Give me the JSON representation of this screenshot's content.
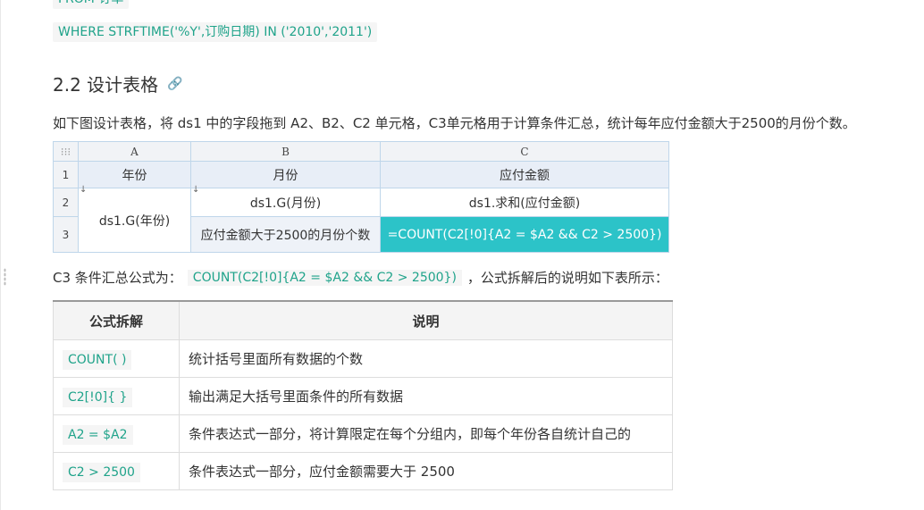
{
  "top_code": {
    "line1": "FROM 订单",
    "line2": "WHERE STRFTIME('%Y',订购日期) IN ('2010','2011')"
  },
  "section": {
    "title": "2.2 设计表格",
    "link_icon": "link-icon"
  },
  "paragraph1": "如下图设计表格，将 ds1 中的字段拖到 A2、B2、C2 单元格，C3单元格用于计算条件汇总，统计每年应付金额大于2500的月份个数。",
  "sheet": {
    "corner_icon": "grid-icon",
    "columns": [
      "A",
      "B",
      "C"
    ],
    "rows": [
      "1",
      "2",
      "3"
    ],
    "r1": [
      "年份",
      "月份",
      "应付金额"
    ],
    "a23": "ds1.G(年份)",
    "b2": "ds1.G(月份)",
    "c2": "ds1.求和(应付金额)",
    "b3": "应付金额大于2500的月份个数",
    "c3": "=COUNT(C2[!0]{A2 = $A2 && C2 > 2500})"
  },
  "paragraph2": {
    "prefix": "C3 条件汇总公式为：",
    "code": "COUNT(C2[!0]{A2 = $A2 && C2 > 2500})",
    "suffix": "，公式拆解后的说明如下表所示："
  },
  "explain_table": {
    "headers": [
      "公式拆解",
      "说明"
    ],
    "rows": [
      {
        "code": "COUNT( )",
        "desc": "统计括号里面所有数据的个数"
      },
      {
        "code": "C2[!0]{ }",
        "desc": "输出满足大括号里面条件的所有数据"
      },
      {
        "code": "A2 = $A2",
        "desc": "条件表达式一部分，将计算限定在每个分组内，即每个年份各自统计自己的"
      },
      {
        "code": "C2 > 2500",
        "desc": "条件表达式一部分，应付金额需要大于 2500"
      }
    ]
  },
  "colors": {
    "code_text": "#1fa38a",
    "highlight_cell": "#2cc3c8"
  }
}
